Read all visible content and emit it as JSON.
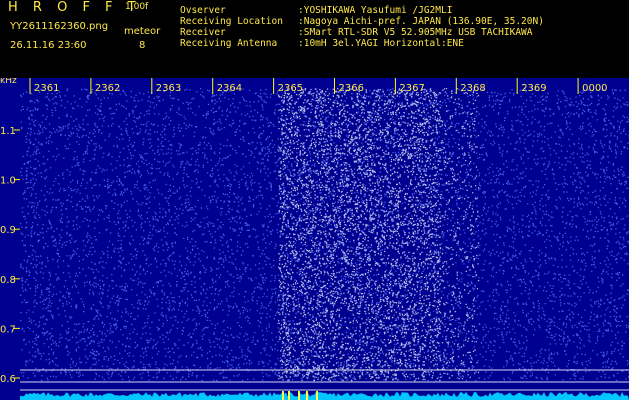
{
  "header": {
    "app_title": "HROFFT",
    "version": "1.00f",
    "filename": "YY2611162360.png",
    "datetime": "26.11.16 23:60",
    "meteor_label": "meteor",
    "meteor_count": "8",
    "info": [
      {
        "key": "Ovserver",
        "value": ":YOSHIKAWA Yasufumi /JG2MLI"
      },
      {
        "key": "Receiving Location",
        "value": ":Nagoya Aichi-pref. JAPAN (136.90E, 35.20N)"
      },
      {
        "key": "Receiver",
        "value": ":SMart RTL-SDR V5 52.905MHz USB TACHIKAWA"
      },
      {
        "key": "Receiving Antenna",
        "value": ":10mH 3el.YAGI Horizontal:ENE"
      }
    ]
  },
  "plot": {
    "y_unit": "kHz",
    "time_labels": [
      "2361",
      "2362",
      "2363",
      "2364",
      "2365",
      "2366",
      "2367",
      "2368",
      "2369",
      "0000"
    ],
    "freq_labels": [
      "1.1",
      "1.0",
      "0.9",
      "0.8",
      "0.7",
      "0.6"
    ],
    "colors": {
      "background": "#000090",
      "noise": "#5a7cff",
      "bright_noise": "#dde9ff",
      "grid_line": "#ffffff",
      "tick": "#ffff00",
      "baseline": "#00c8ff",
      "label": "#ffe84a"
    }
  }
}
